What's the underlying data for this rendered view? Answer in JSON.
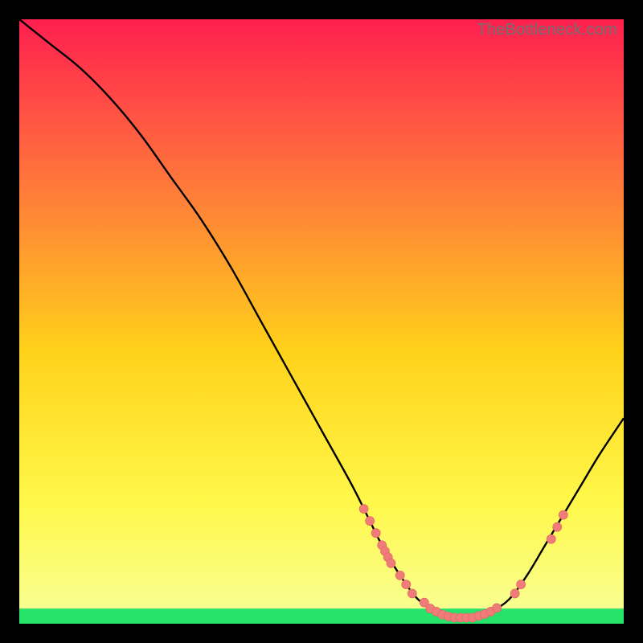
{
  "watermark": "TheBottleneck.com",
  "colors": {
    "bg": "#000000",
    "curve": "#000000",
    "marker_fill": "#ef7c78",
    "marker_stroke": "#e56a66",
    "green_band": "#26e36a",
    "gradient_top": "#ff1f4f",
    "gradient_mid_upper": "#ff7a3a",
    "gradient_mid": "#ffd21a",
    "gradient_mid_lower": "#fff84a",
    "gradient_bottom": "#f8ff9a"
  },
  "chart_data": {
    "type": "line",
    "title": "",
    "xlabel": "",
    "ylabel": "",
    "xlim": [
      0,
      100
    ],
    "ylim": [
      0,
      100
    ],
    "curve": [
      {
        "x": 0,
        "y": 100
      },
      {
        "x": 5,
        "y": 96
      },
      {
        "x": 10,
        "y": 92
      },
      {
        "x": 15,
        "y": 87
      },
      {
        "x": 20,
        "y": 81
      },
      {
        "x": 25,
        "y": 74
      },
      {
        "x": 30,
        "y": 67
      },
      {
        "x": 35,
        "y": 59
      },
      {
        "x": 40,
        "y": 50
      },
      {
        "x": 45,
        "y": 41
      },
      {
        "x": 50,
        "y": 32
      },
      {
        "x": 55,
        "y": 23
      },
      {
        "x": 58,
        "y": 17
      },
      {
        "x": 60,
        "y": 13
      },
      {
        "x": 63,
        "y": 8
      },
      {
        "x": 66,
        "y": 4
      },
      {
        "x": 69,
        "y": 2
      },
      {
        "x": 72,
        "y": 1
      },
      {
        "x": 75,
        "y": 1
      },
      {
        "x": 78,
        "y": 2
      },
      {
        "x": 81,
        "y": 4
      },
      {
        "x": 84,
        "y": 8
      },
      {
        "x": 87,
        "y": 13
      },
      {
        "x": 90,
        "y": 18
      },
      {
        "x": 93,
        "y": 23
      },
      {
        "x": 96,
        "y": 28
      },
      {
        "x": 100,
        "y": 34
      }
    ],
    "markers": [
      {
        "x": 57,
        "y": 19
      },
      {
        "x": 58,
        "y": 17
      },
      {
        "x": 59,
        "y": 15
      },
      {
        "x": 60,
        "y": 13
      },
      {
        "x": 60.5,
        "y": 12
      },
      {
        "x": 61,
        "y": 11
      },
      {
        "x": 61.5,
        "y": 10
      },
      {
        "x": 63,
        "y": 8
      },
      {
        "x": 64,
        "y": 6.5
      },
      {
        "x": 65,
        "y": 5
      },
      {
        "x": 67,
        "y": 3.5
      },
      {
        "x": 68,
        "y": 2.5
      },
      {
        "x": 69,
        "y": 2
      },
      {
        "x": 70,
        "y": 1.5
      },
      {
        "x": 71,
        "y": 1.2
      },
      {
        "x": 72,
        "y": 1
      },
      {
        "x": 73,
        "y": 1
      },
      {
        "x": 74,
        "y": 1
      },
      {
        "x": 75,
        "y": 1
      },
      {
        "x": 76,
        "y": 1.3
      },
      {
        "x": 77,
        "y": 1.6
      },
      {
        "x": 78,
        "y": 2
      },
      {
        "x": 79,
        "y": 2.6
      },
      {
        "x": 82,
        "y": 5
      },
      {
        "x": 83,
        "y": 6.5
      },
      {
        "x": 88,
        "y": 14
      },
      {
        "x": 89,
        "y": 16
      },
      {
        "x": 90,
        "y": 18
      }
    ],
    "marker_radius": 5.5,
    "green_band_top_y": 2.5
  }
}
